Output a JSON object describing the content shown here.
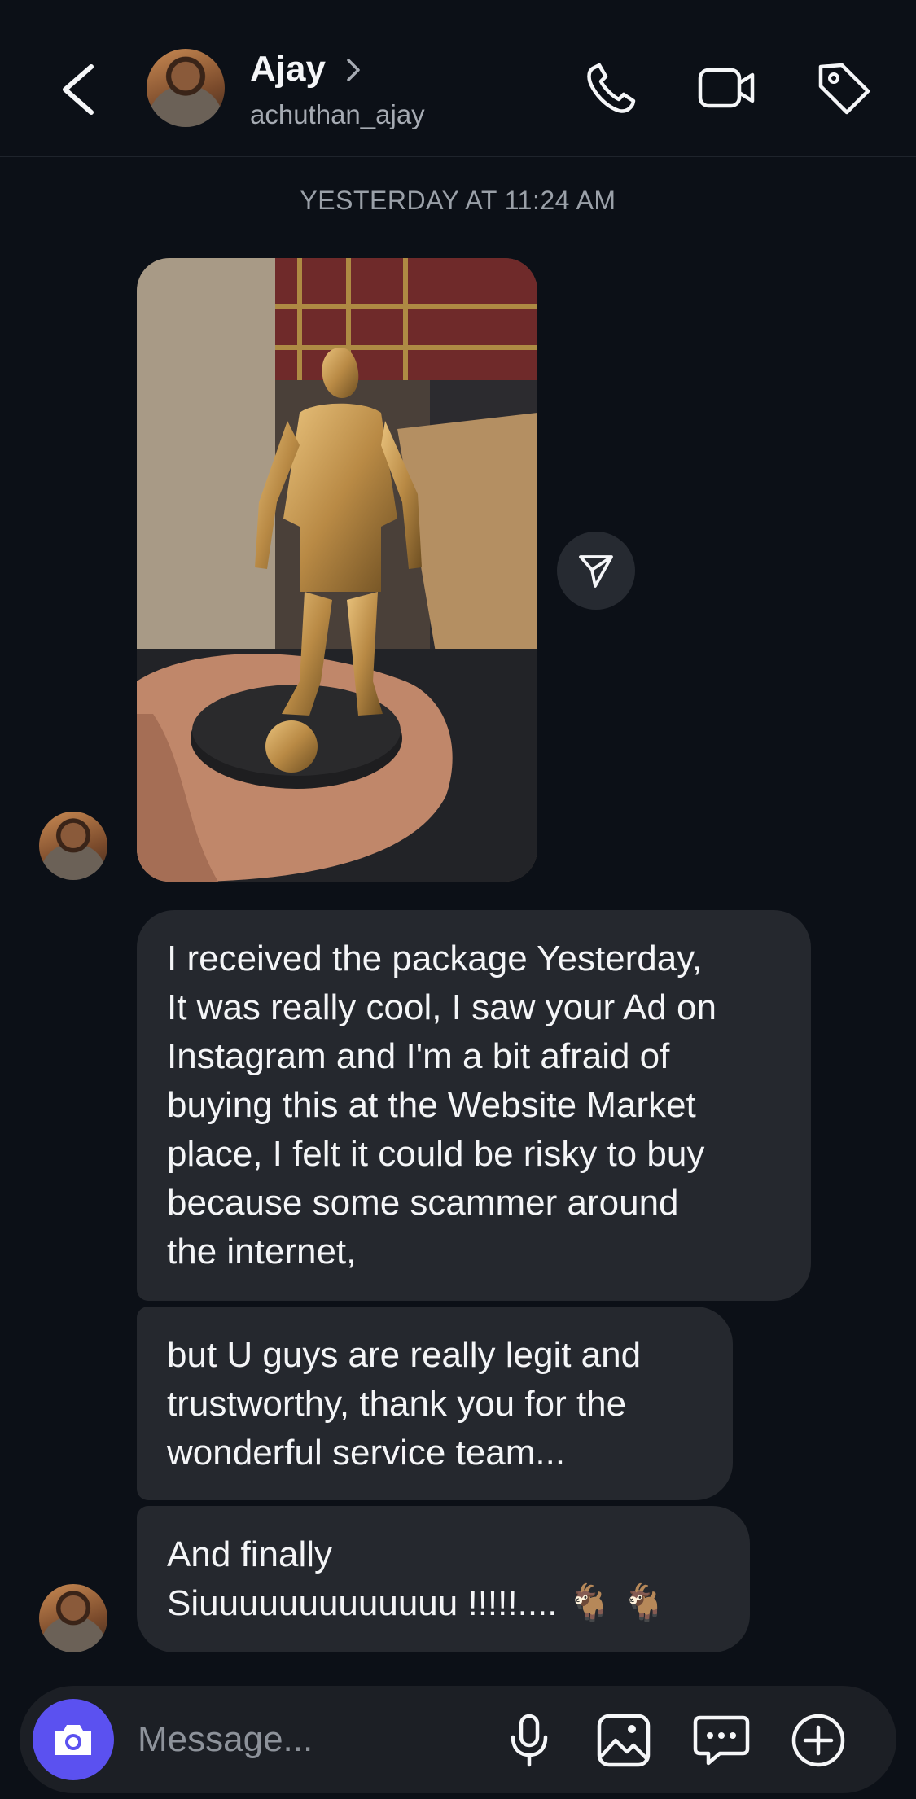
{
  "header": {
    "name": "Ajay",
    "handle": "achuthan_ajay",
    "icons": [
      "back-icon",
      "chevron-right-icon",
      "phone-icon",
      "video-camera-icon",
      "tag-icon"
    ]
  },
  "thread": {
    "timestamp": "YESTERDAY AT 11:24 AM",
    "messages": [
      {
        "type": "image",
        "alt": ""
      },
      {
        "type": "text",
        "text": "I received the package Yesterday,\nIt was really cool, I saw your Ad on\nInstagram and I'm a bit afraid of\nbuying this at the Website Market\nplace, I felt it could be risky to buy\nbecause some scammer around\nthe internet,"
      },
      {
        "type": "text",
        "text": "but U guys are really legit and\ntrustworthy, thank you for the\nwonderful service team..."
      },
      {
        "type": "text",
        "text": "And finally\nSiuuuuuuuuuuuuu !!!!!.... 🐐 🐐"
      }
    ]
  },
  "composer": {
    "placeholder": "Message...",
    "value": "",
    "icons": [
      "camera-icon",
      "microphone-icon",
      "gallery-icon",
      "sticker-chat-icon",
      "plus-icon"
    ]
  },
  "colors": {
    "background": "#0c1017",
    "bubble": "#25282e",
    "accent": "#5b51f0",
    "muted_text": "#9aa0a8"
  }
}
